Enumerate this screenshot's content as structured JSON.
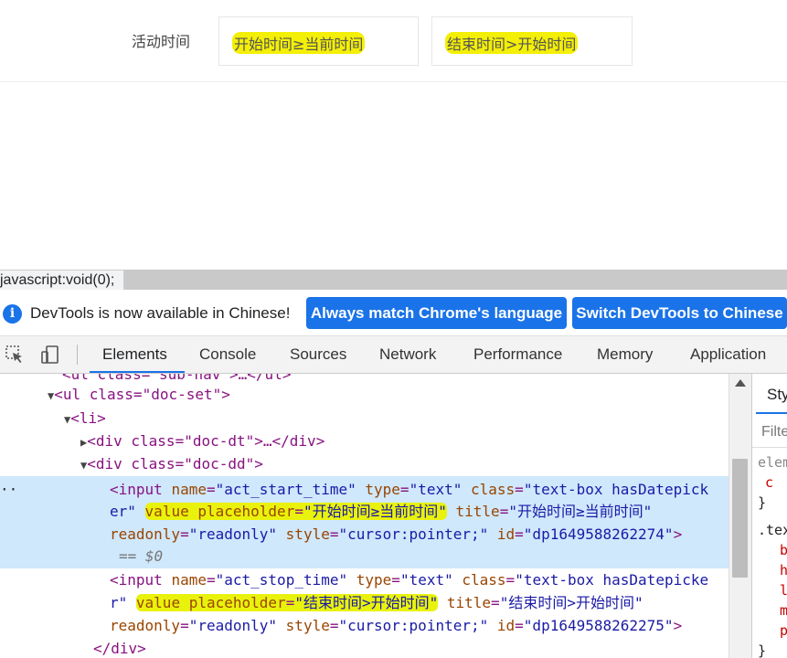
{
  "page": {
    "activity_label": "活动时间",
    "start_placeholder": "开始时间≥当前时间",
    "end_placeholder": "结束时间>开始时间"
  },
  "statusbar": {
    "url": "javascript:void(0);"
  },
  "devtools": {
    "infobar": {
      "icon": "info-icon",
      "message": "DevTools is now available in Chinese!",
      "btn_match": "Always match Chrome's language",
      "btn_switch": "Switch DevTools to Chinese"
    },
    "toolbar_icons": [
      "inspect-element-icon",
      "device-toolbar-icon"
    ],
    "tabs": [
      "Elements",
      "Console",
      "Sources",
      "Network",
      "Performance",
      "Memory",
      "Application"
    ],
    "active_tab": "Elements",
    "dom": {
      "partial_top": "<ul class=\"sub-nav\">…</ul>",
      "ul_open": "<ul class=\"doc-set\">",
      "li_open": "<li>",
      "div_dt": "<div class=\"doc-dt\">…</div>",
      "div_dd_open": "<div class=\"doc-dd\">",
      "input1": {
        "tag_name": "input",
        "name_attr": "name",
        "name_val": "\"act_start_time\"",
        "type_attr": "type",
        "type_val": "\"text\"",
        "class_attr": "class",
        "class_val_part1": "\"text-box hasDatepick",
        "class_val_part2": "er\"",
        "value_attr": "value",
        "placeholder_attr": "placeholder",
        "placeholder_val": "\"开始时间≥当前时间\"",
        "title_attr": "title",
        "title_val": "\"开始时间≥当前时间\"",
        "readonly_attr": "readonly",
        "readonly_val": "\"readonly\"",
        "style_attr": "style",
        "style_val": "\"cursor:pointer;\"",
        "id_attr": "id",
        "id_val": "\"dp1649588262274\"",
        "selected_marker": "== $0"
      },
      "input2": {
        "tag_name": "input",
        "name_attr": "name",
        "name_val": "\"act_stop_time\"",
        "type_attr": "type",
        "type_val": "\"text\"",
        "class_attr": "class",
        "class_val_part1": "\"text-box hasDatepicke",
        "class_val_part2": "r\"",
        "value_attr": "value",
        "placeholder_attr": "placeholder",
        "placeholder_val": "\"结束时间>开始时间\"",
        "title_attr": "title",
        "title_val": "\"结束时间>开始时间\"",
        "readonly_attr": "readonly",
        "readonly_val": "\"readonly\"",
        "style_attr": "style",
        "style_val": "\"cursor:pointer;\"",
        "id_attr": "id",
        "id_val": "\"dp1649588262275\""
      },
      "div_close": "</div>"
    },
    "styles": {
      "tab": "Styles",
      "filter_placeholder": "Filter",
      "rule1_selector": "element.style",
      "rule2_selector": ".text-box"
    }
  },
  "colors": {
    "accent": "#1a73e8",
    "highlight": "#f4ef06",
    "selected_row": "#cfe8fc"
  }
}
